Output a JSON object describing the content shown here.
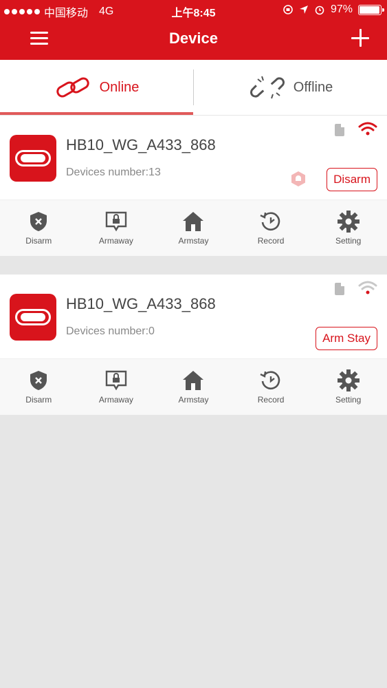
{
  "status_bar": {
    "carrier": "中国移动",
    "network": "4G",
    "time": "上午8:45",
    "battery": "97%",
    "battery_level": 0.97
  },
  "header": {
    "title": "Device",
    "menu_icon": "hamburger-menu-icon",
    "add_icon": "plus-icon"
  },
  "tabs": [
    {
      "label": "Online",
      "icon": "link-icon",
      "active": true
    },
    {
      "label": "Offline",
      "icon": "broken-link-icon",
      "active": false
    }
  ],
  "devices": [
    {
      "name": "HB10_WG_A433_868",
      "count_text": "Devices number:13",
      "state_button": "Disarm",
      "signal_color": "#d8141c",
      "show_alarm_icon": true
    },
    {
      "name": "HB10_WG_A433_868",
      "count_text": "Devices number:0",
      "state_button": "Arm Stay",
      "signal_color": "#c8c8c8",
      "show_alarm_icon": false
    }
  ],
  "actions": [
    "Disarm",
    "Armaway",
    "Armstay",
    "Record",
    "Setting"
  ],
  "colors": {
    "brand_red": "#d8141c",
    "background": "#e6e6e6"
  }
}
